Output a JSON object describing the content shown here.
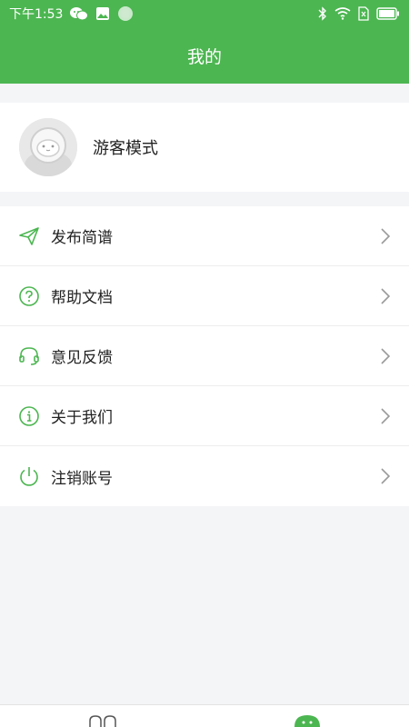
{
  "status_bar": {
    "time": "下午1:53",
    "left_icons": [
      "wechat-icon",
      "image-icon",
      "loading-icon"
    ],
    "right_icons": [
      "bluetooth-icon",
      "wifi-icon",
      "sim-icon",
      "battery-icon"
    ]
  },
  "header": {
    "title": "我的"
  },
  "profile": {
    "name": "游客模式",
    "avatar_icon": "avatar-face-icon"
  },
  "menu": {
    "items": [
      {
        "label": "发布简谱",
        "icon": "send-icon"
      },
      {
        "label": "帮助文档",
        "icon": "help-icon"
      },
      {
        "label": "意见反馈",
        "icon": "headset-icon"
      },
      {
        "label": "关于我们",
        "icon": "info-icon"
      },
      {
        "label": "注销账号",
        "icon": "power-icon"
      }
    ]
  },
  "colors": {
    "brand_green": "#4cb651",
    "background": "#f4f5f7",
    "chevron": "#9a9a9a"
  },
  "bottom_nav": {
    "tabs": [
      "home-tab-icon",
      "profile-tab-icon"
    ]
  }
}
